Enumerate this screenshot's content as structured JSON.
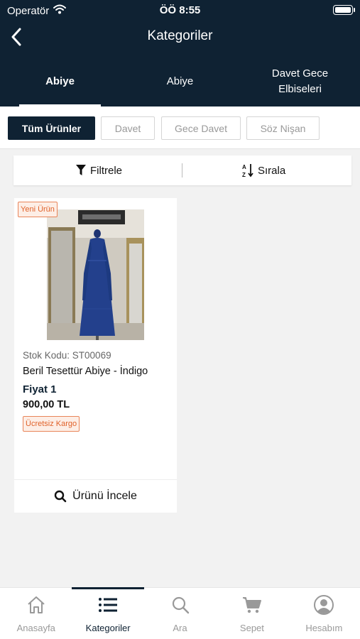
{
  "status_bar": {
    "carrier": "Operatör",
    "time": "ÖÖ 8:55"
  },
  "nav": {
    "title": "Kategoriler"
  },
  "tabs": [
    {
      "label": "Abiye",
      "active": true
    },
    {
      "label": "Abiye",
      "active": false
    },
    {
      "label": "Davet Gece Elbiseleri",
      "active": false
    }
  ],
  "chips": [
    {
      "label": "Tüm Ürünler",
      "active": true
    },
    {
      "label": "Davet",
      "active": false
    },
    {
      "label": "Gece Davet",
      "active": false
    },
    {
      "label": "Söz Nişan",
      "active": false
    }
  ],
  "filter_bar": {
    "filter_label": "Filtrele",
    "sort_label": "Sırala"
  },
  "product": {
    "badge": "Yeni Ürün",
    "stock_code": "Stok Kodu: ST00069",
    "name": "Beril Tesettür Abiye - İndigo",
    "price_label": "Fiyat 1",
    "price": "900,00 TL",
    "shipping_badge": "Ücretsiz Kargo",
    "inspect_label": "Ürünü İncele"
  },
  "bottom_nav": [
    {
      "label": "Anasayfa",
      "icon": "home-icon",
      "active": false
    },
    {
      "label": "Kategoriler",
      "icon": "list-icon",
      "active": true
    },
    {
      "label": "Ara",
      "icon": "search-icon",
      "active": false
    },
    {
      "label": "Sepet",
      "icon": "cart-icon",
      "active": false
    },
    {
      "label": "Hesabım",
      "icon": "account-icon",
      "active": false
    }
  ],
  "colors": {
    "primary": "#0f2233",
    "accent": "#e0622a",
    "background": "#f2f2f2"
  }
}
